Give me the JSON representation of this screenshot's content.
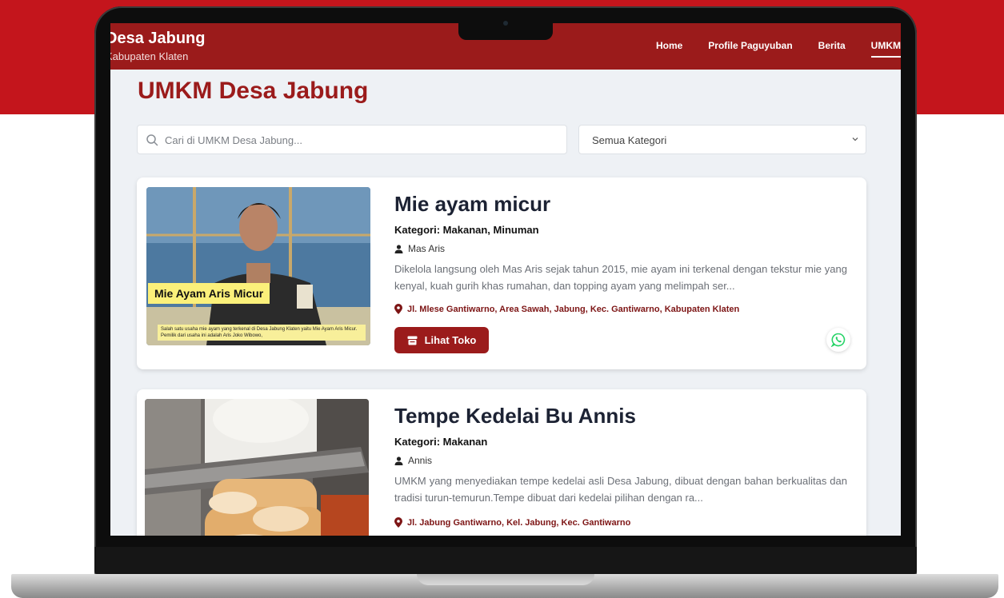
{
  "header": {
    "brand_title": "Desa Jabung",
    "brand_subtitle": "Kabupaten Klaten",
    "nav": [
      "Home",
      "Profile Paguyuban",
      "Berita",
      "UMKM"
    ]
  },
  "page": {
    "title": "UMKM Desa Jabung"
  },
  "search": {
    "placeholder": "Cari di UMKM Desa Jabung..."
  },
  "filter": {
    "selected": "Semua Kategori"
  },
  "cards": [
    {
      "title": "Mie ayam micur",
      "category": "Kategori: Makanan, Minuman",
      "owner": "Mas Aris",
      "description": "Dikelola langsung oleh Mas Aris sejak tahun 2015, mie ayam ini terkenal dengan tekstur mie yang kenyal, kuah gurih khas rumahan, dan topping ayam yang melimpah ser...",
      "address": "Jl. Mlese Gantiwarno, Area Sawah, Jabung, Kec. Gantiwarno, Kabupaten Klaten",
      "button": "Lihat Toko",
      "thumb_caption": "Mie Ayam Aris Micur",
      "thumb_text": "Salah satu usaha mie ayam yang terkenal di Desa Jabung Klaten yaitu Mie Ayam Aris Micur. Pemilik dari usaha ini adalah Aris Joko Wibowo,"
    },
    {
      "title": "Tempe Kedelai Bu Annis",
      "category": "Kategori: Makanan",
      "owner": "Annis",
      "description": "UMKM yang menyediakan tempe kedelai asli Desa Jabung, dibuat dengan bahan berkualitas dan tradisi turun-temurun.Tempe dibuat dari kedelai pilihan dengan ra...",
      "address": "Jl. Jabung Gantiwarno, Kel. Jabung, Kec. Gantiwarno"
    }
  ],
  "colors": {
    "brand": "#9b1b1b",
    "backdrop": "#c4151c",
    "whatsapp": "#25d366"
  }
}
